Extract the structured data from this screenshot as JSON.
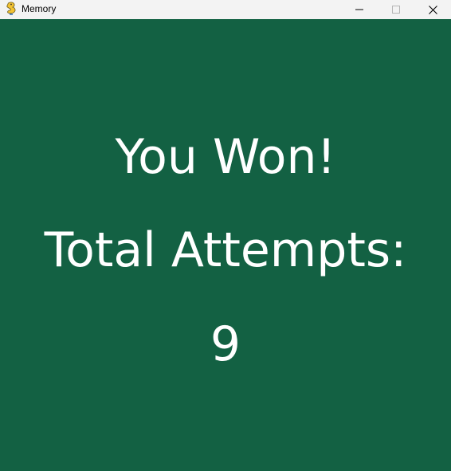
{
  "window": {
    "title": "Memory",
    "app_icon": "pygame-snake-icon"
  },
  "controls": {
    "minimize_icon": "minimize-icon",
    "maximize_icon": "maximize-icon",
    "close_icon": "close-icon"
  },
  "game": {
    "background_color": "#136143",
    "text_color": "#ffffff",
    "win_message": "You Won!",
    "attempts_label": "Total Attempts:",
    "attempts_value": "9"
  }
}
